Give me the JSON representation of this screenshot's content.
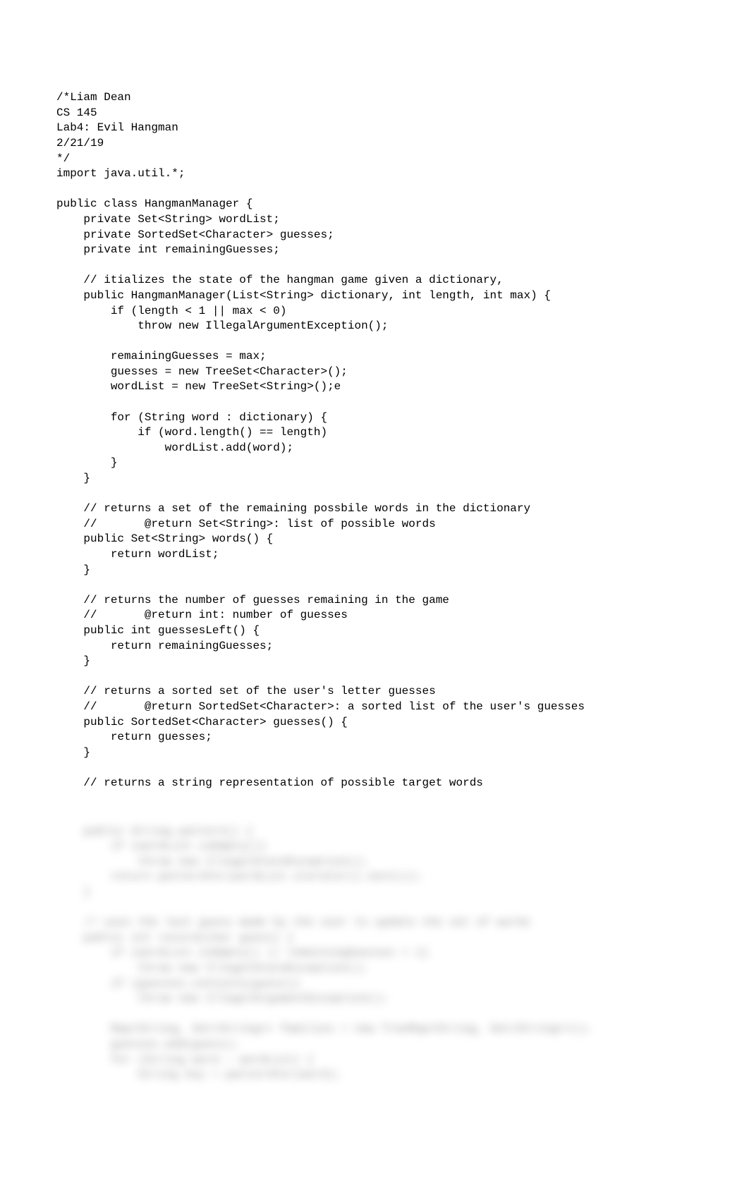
{
  "code_lines": [
    "/*Liam Dean",
    "CS 145",
    "Lab4: Evil Hangman",
    "2/21/19",
    "*/",
    "import java.util.*;",
    "",
    "public class HangmanManager {",
    "    private Set<String> wordList;",
    "    private SortedSet<Character> guesses;",
    "    private int remainingGuesses;",
    "",
    "    // itializes the state of the hangman game given a dictionary,",
    "    public HangmanManager(List<String> dictionary, int length, int max) {",
    "        if (length < 1 || max < 0)",
    "            throw new IllegalArgumentException();",
    "",
    "        remainingGuesses = max;",
    "        guesses = new TreeSet<Character>();",
    "        wordList = new TreeSet<String>();e",
    "",
    "        for (String word : dictionary) {",
    "            if (word.length() == length)",
    "                wordList.add(word);",
    "        }",
    "    }",
    "",
    "    // returns a set of the remaining possbile words in the dictionary",
    "    //       @return Set<String>: list of possible words",
    "    public Set<String> words() {",
    "        return wordList;",
    "    }",
    "",
    "    // returns the number of guesses remaining in the game",
    "    //       @return int: number of guesses",
    "    public int guessesLeft() {",
    "        return remainingGuesses;",
    "    }",
    "",
    "    // returns a sorted set of the user's letter guesses",
    "    //       @return SortedSet<Character>: a sorted list of the user's guesses",
    "    public SortedSet<Character> guesses() {",
    "        return guesses;",
    "    }",
    "",
    "    // returns a string representation of possible target words"
  ],
  "blurred_lines": [
    "    public String pattern() {",
    "        if (wordList.isEmpty())",
    "            throw new IllegalStateException();",
    "        return patternFor(wordList.iterator().next());",
    "    }",
    "",
    "    // uses the last guess made by the user to update the set of words",
    "    public int record(char guess) {",
    "        if (wordList.isEmpty() || remainingGuesses < 1)",
    "            throw new IllegalStateException();",
    "        if (guesses.contains(guess))",
    "            throw new IllegalArgumentException();",
    "",
    "        Map<String, Set<String>> families = new TreeMap<String, Set<String>>();",
    "        guesses.add(guess);",
    "        for (String word : wordList) {",
    "            String key = patternFor(word);"
  ]
}
